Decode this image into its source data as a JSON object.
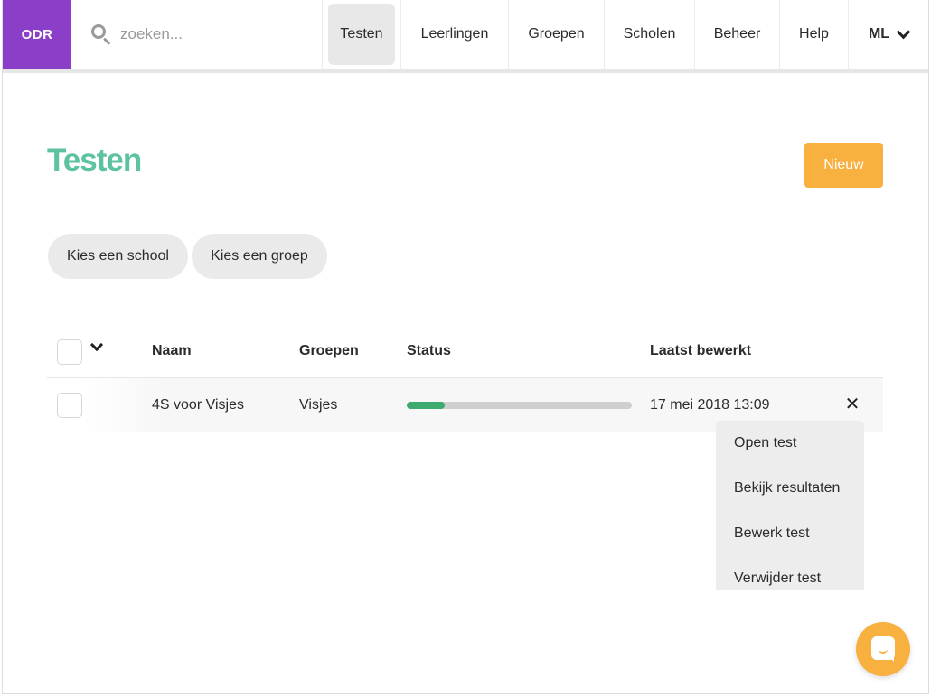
{
  "nav": {
    "logo": "ODR",
    "search_placeholder": "zoeken...",
    "items": [
      {
        "label": "Testen",
        "active": true
      },
      {
        "label": "Leerlingen"
      },
      {
        "label": "Groepen"
      },
      {
        "label": "Scholen"
      },
      {
        "label": "Beheer"
      },
      {
        "label": "Help"
      }
    ],
    "user_initials": "ML"
  },
  "page": {
    "title": "Testen",
    "new_button": "Nieuw"
  },
  "filters": {
    "school": "Kies een school",
    "group": "Kies een groep"
  },
  "table": {
    "headers": {
      "name": "Naam",
      "groups": "Groepen",
      "status": "Status",
      "last_edited": "Laatst bewerkt"
    },
    "rows": [
      {
        "name": "4S voor Visjes",
        "groups": "Visjes",
        "status_progress": 0.17,
        "last_edited": "17 mei 2018 13:09"
      }
    ]
  },
  "row_menu": {
    "close_symbol": "✕",
    "items": [
      "Open test",
      "Bekijk resultaten",
      "Bewerk test",
      "Verwijder test"
    ]
  },
  "colors": {
    "brand_purple": "#8b3fc8",
    "title_green": "#5cc2a2",
    "accent_orange": "#f8b03e",
    "progress_green": "#3daa6f"
  },
  "icons": [
    "search-icon",
    "chevron-down-icon",
    "close-icon",
    "chat-icon"
  ]
}
